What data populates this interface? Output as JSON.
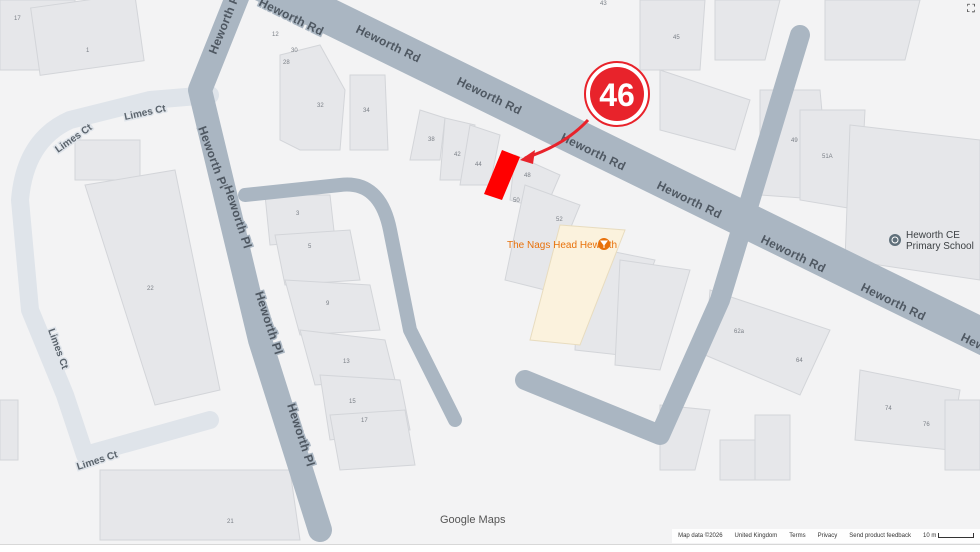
{
  "map": {
    "roads": {
      "heworth_rd": "Heworth Rd",
      "heworth_pl": "Heworth Pl",
      "limes_ct": "Limes Ct"
    },
    "house_numbers": [
      "17",
      "1",
      "12",
      "30",
      "28",
      "32",
      "34",
      "38",
      "42",
      "44",
      "48",
      "50",
      "52",
      "43",
      "45",
      "49",
      "51A",
      "3",
      "5",
      "9",
      "13",
      "15",
      "17",
      "22",
      "21",
      "62a",
      "64",
      "74",
      "76"
    ],
    "marker": {
      "label": "46",
      "color": "#e8232b"
    },
    "highlighted_building": {
      "color": "#ff0000"
    },
    "pois": {
      "pub": {
        "name": "The Nags Head Heworth",
        "color": "#e8710a"
      },
      "school": {
        "name_line1": "Heworth CE",
        "name_line2": "Primary School",
        "color": "#3c4043"
      }
    },
    "colors": {
      "road": "#aab6c2",
      "building": "#e6e7ea",
      "land": "#f3f3f4",
      "pub_area": "#fbf2dd"
    }
  },
  "attribution": {
    "logo_google": "Google",
    "logo_maps": "Maps",
    "map_data": "Map data ©2026",
    "region": "United Kingdom",
    "terms": "Terms",
    "privacy": "Privacy",
    "feedback": "Send product feedback",
    "scale": "10 m"
  }
}
